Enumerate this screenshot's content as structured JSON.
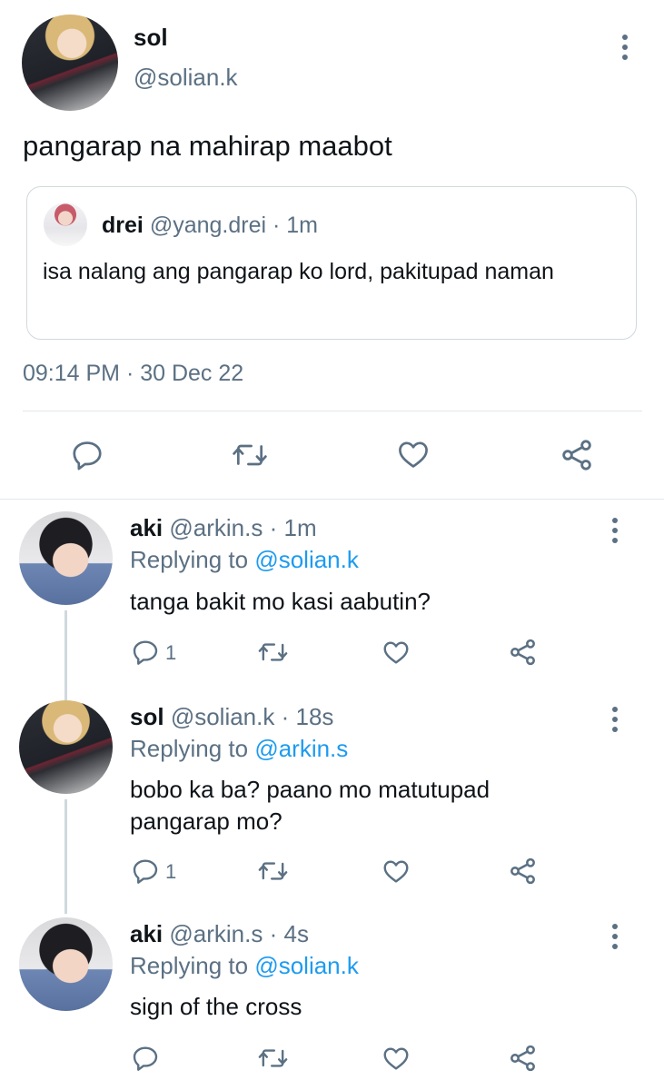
{
  "main_tweet": {
    "name": "sol",
    "handle": "@solian.k",
    "text": "pangarap na mahirap maabot",
    "timestamp": "09:14 PM · 30 Dec 22"
  },
  "quoted_tweet": {
    "name": "drei",
    "handle": "@yang.drei",
    "time": "· 1m",
    "text": "isa nalang ang pangarap ko lord, pakitupad naman"
  },
  "replies": [
    {
      "name": "aki",
      "handle": "@arkin.s",
      "time": "· 1m",
      "replying_prefix": "Replying to",
      "replying_to": "@solian.k",
      "text": "tanga bakit mo kasi aabutin?",
      "reply_count": "1"
    },
    {
      "name": "sol",
      "handle": "@solian.k",
      "time": "· 18s",
      "replying_prefix": "Replying to",
      "replying_to": "@arkin.s",
      "text_line1": "bobo ka ba? paano mo matutupad",
      "text_line2": "pangarap mo?",
      "reply_count": "1"
    },
    {
      "name": "aki",
      "handle": "@arkin.s",
      "time": "· 4s",
      "replying_prefix": "Replying to",
      "replying_to": "@solian.k",
      "text": "sign of the cross",
      "reply_count": ""
    }
  ],
  "icons": [
    "reply-icon",
    "retweet-icon",
    "like-icon",
    "share-icon",
    "more-options-icon"
  ],
  "colors": {
    "text": "#0f1419",
    "secondary": "#5b7083",
    "link": "#1d9bf0",
    "divider": "#e1e8ed"
  }
}
